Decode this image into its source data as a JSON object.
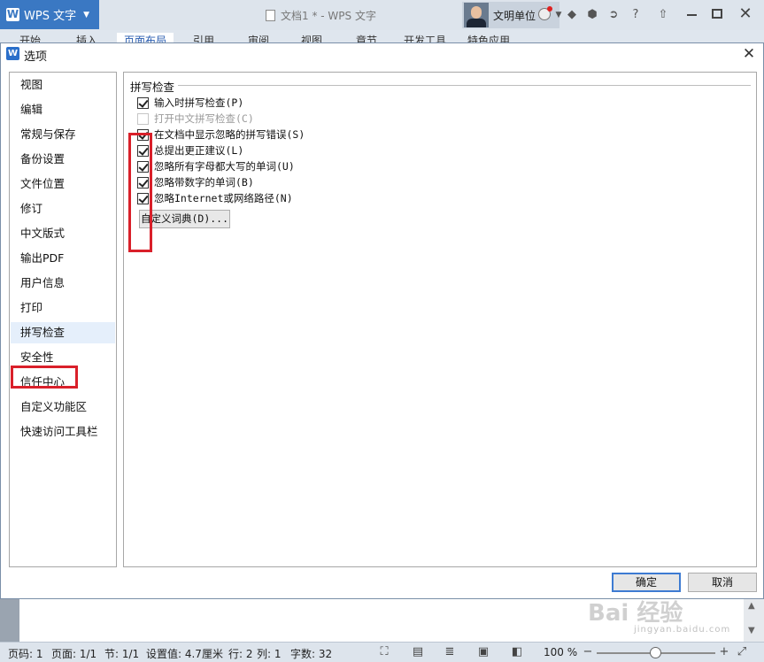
{
  "app": {
    "name": "WPS 文字",
    "logo_letter": "W",
    "doc_title": "文档1 * - WPS 文字"
  },
  "user": {
    "name": "文明单位"
  },
  "ribbon_tabs": [
    "开始",
    "插入",
    "页面布局",
    "引用",
    "审阅",
    "视图",
    "章节",
    "开发工具",
    "特色应用"
  ],
  "dialog": {
    "title": "选项",
    "categories": [
      "视图",
      "编辑",
      "常规与保存",
      "备份设置",
      "文件位置",
      "修订",
      "中文版式",
      "输出PDF",
      "用户信息",
      "打印",
      "拼写检查",
      "安全性",
      "信任中心",
      "自定义功能区",
      "快速访问工具栏"
    ],
    "selected_category": "拼写检查",
    "group_title": "拼写检查",
    "options": [
      {
        "label": "输入时拼写检查(P)",
        "checked": true,
        "enabled": true
      },
      {
        "label": "打开中文拼写检查(C)",
        "checked": false,
        "enabled": false
      },
      {
        "label": "在文档中显示忽略的拼写错误(S)",
        "checked": true,
        "enabled": true
      },
      {
        "label": "总提出更正建议(L)",
        "checked": true,
        "enabled": true
      },
      {
        "label": "忽略所有字母都大写的单词(U)",
        "checked": true,
        "enabled": true
      },
      {
        "label": "忽略带数字的单词(B)",
        "checked": true,
        "enabled": true
      },
      {
        "label": "忽略Internet或网络路径(N)",
        "checked": true,
        "enabled": true
      }
    ],
    "custom_dict_button": "自定义词典(D)...",
    "ok_button": "确定",
    "cancel_button": "取消",
    "highlight_color": "#d9202a"
  },
  "statusbar": {
    "page_no": "页码: 1",
    "page": "页面: 1/1",
    "section": "节: 1/1",
    "setting": "设置值: 4.7厘米",
    "row": "行: 2",
    "col": "列: 1",
    "word_count": "字数: 32",
    "zoom": "100 %",
    "zoom_level": 100
  },
  "watermark": {
    "text": "Bai 经验",
    "sub": "jingyan.baidu.com"
  },
  "colors": {
    "accent": "#3a78c3",
    "selection": "#e5effb"
  }
}
